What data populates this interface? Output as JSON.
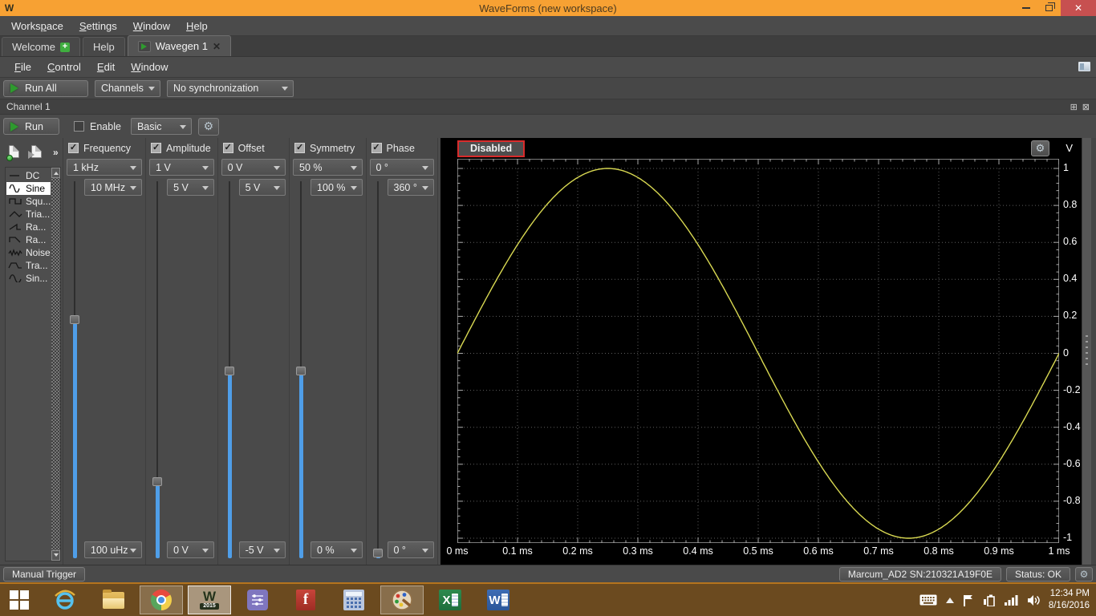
{
  "window": {
    "title": "WaveForms  (new workspace)"
  },
  "menubar": {
    "items": [
      {
        "label": "Workspace",
        "mnemonic": 5
      },
      {
        "label": "Settings",
        "mnemonic": 0
      },
      {
        "label": "Window",
        "mnemonic": 0
      },
      {
        "label": "Help",
        "mnemonic": 0
      }
    ]
  },
  "tabs": [
    {
      "label": "Welcome",
      "icon": "plus"
    },
    {
      "label": "Help",
      "icon": null
    },
    {
      "label": "Wavegen 1",
      "icon": "play",
      "closable": true,
      "active": true
    }
  ],
  "wavegen_menu": {
    "items": [
      {
        "label": "File",
        "mnemonic": 0
      },
      {
        "label": "Control",
        "mnemonic": 0
      },
      {
        "label": "Edit",
        "mnemonic": 0
      },
      {
        "label": "Window",
        "mnemonic": 0
      }
    ]
  },
  "toolbar": {
    "run_all_label": "Run All",
    "channels_dropdown": "Channels",
    "sync_dropdown": "No synchronization"
  },
  "channel": {
    "title": "Channel 1",
    "run_label": "Run",
    "enable_label": "Enable",
    "mode_dropdown": "Basic",
    "more_chevron": "»",
    "waveforms": [
      {
        "name": "DC",
        "icon": "dc",
        "selected": false
      },
      {
        "name": "Sine",
        "icon": "sine",
        "selected": true
      },
      {
        "name": "Squ...",
        "icon": "square",
        "selected": false
      },
      {
        "name": "Tria...",
        "icon": "triangle",
        "selected": false
      },
      {
        "name": "Ra...",
        "icon": "rampup",
        "selected": false
      },
      {
        "name": "Ra...",
        "icon": "rampdown",
        "selected": false
      },
      {
        "name": "Noise",
        "icon": "noise",
        "selected": false
      },
      {
        "name": "Tra...",
        "icon": "trapezium",
        "selected": false
      },
      {
        "name": "Sin...",
        "icon": "sinepower",
        "selected": false
      }
    ],
    "params": [
      {
        "label": "Frequency",
        "checked": true,
        "value": "1 kHz",
        "max": "10 MHz",
        "min": "100 uHz",
        "slider_frac": 0.365
      },
      {
        "label": "Amplitude",
        "checked": true,
        "value": "1 V",
        "max": "5 V",
        "min": "0 V",
        "slider_frac": 0.806
      },
      {
        "label": "Offset",
        "checked": true,
        "value": "0 V",
        "max": "5 V",
        "min": "-5 V",
        "slider_frac": 0.504
      },
      {
        "label": "Symmetry",
        "checked": true,
        "value": "50 %",
        "max": "100 %",
        "min": "0 %",
        "slider_frac": 0.504
      },
      {
        "label": "Phase",
        "checked": true,
        "value": "0 °",
        "max": "360 °",
        "min": "0 °",
        "slider_frac": 1.0
      }
    ]
  },
  "chart_data": {
    "type": "line",
    "status_label": "Disabled",
    "y_axis_unit": "V",
    "xlabel_unit": "ms",
    "xlim_ms": [
      0,
      1
    ],
    "ylim": [
      -1,
      1
    ],
    "grid": {
      "x_divisions": 10,
      "y_divisions": 10,
      "style": "dotted"
    },
    "x_ticks": [
      "0 ms",
      "0.1 ms",
      "0.2 ms",
      "0.3 ms",
      "0.4 ms",
      "0.5 ms",
      "0.6 ms",
      "0.7 ms",
      "0.8 ms",
      "0.9 ms",
      "1 ms"
    ],
    "y_ticks": [
      "1",
      "0.8",
      "0.6",
      "0.4",
      "0.2",
      "0",
      "-0.2",
      "-0.4",
      "-0.6",
      "-0.8",
      "-1"
    ],
    "series": [
      {
        "name": "Channel 1",
        "color": "#d9d952",
        "waveform": "sine",
        "frequency_khz": 1,
        "cycles_in_view": 1,
        "amplitude_v": 1,
        "offset_v": 0,
        "phase_deg": 0,
        "x_ms": [
          0,
          0.05,
          0.1,
          0.15,
          0.2,
          0.25,
          0.3,
          0.35,
          0.4,
          0.45,
          0.5,
          0.55,
          0.6,
          0.65,
          0.7,
          0.75,
          0.8,
          0.85,
          0.9,
          0.95,
          1
        ],
        "y_v": [
          0,
          0.309,
          0.588,
          0.809,
          0.951,
          1,
          0.951,
          0.809,
          0.588,
          0.309,
          0,
          -0.309,
          -0.588,
          -0.809,
          -0.951,
          -1,
          -0.951,
          -0.809,
          -0.588,
          -0.309,
          0
        ]
      }
    ]
  },
  "statusbar": {
    "manual_trigger_label": "Manual Trigger",
    "device_label": "Marcum_AD2 SN:210321A19F0E",
    "status_label": "Status: OK"
  },
  "taskbar": {
    "apps": [
      {
        "id": "start",
        "running": false,
        "active": false
      },
      {
        "id": "internet-explorer",
        "running": false,
        "active": false
      },
      {
        "id": "file-explorer",
        "running": false,
        "active": false
      },
      {
        "id": "chrome",
        "running": true,
        "active": false
      },
      {
        "id": "waveforms",
        "running": true,
        "active": true
      },
      {
        "id": "circuit-tool",
        "running": false,
        "active": false
      },
      {
        "id": "fritzing",
        "running": false,
        "active": false
      },
      {
        "id": "calculator",
        "running": false,
        "active": false
      },
      {
        "id": "paint",
        "running": true,
        "active": false
      },
      {
        "id": "excel",
        "running": false,
        "active": false
      },
      {
        "id": "word",
        "running": false,
        "active": false
      }
    ],
    "tray": {
      "time": "12:34 PM",
      "date": "8/16/2016"
    }
  }
}
